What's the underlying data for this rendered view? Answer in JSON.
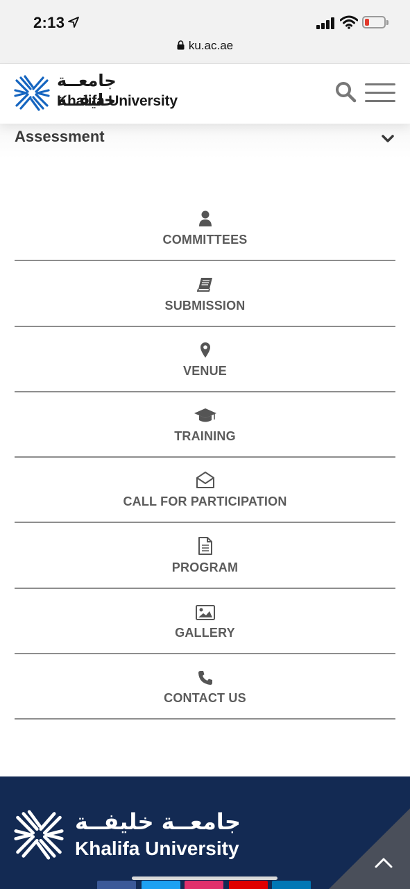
{
  "status_bar": {
    "time": "2:13",
    "url": "ku.ac.ae"
  },
  "header": {
    "logo_arabic": "جامعــة خليفــة",
    "logo_english": "Khalifa University",
    "search_icon": "search-icon",
    "menu_icon": "hamburger-menu-icon"
  },
  "accordion": {
    "title": "Assessment",
    "icon": "chevron-down-icon"
  },
  "nav": {
    "items": [
      {
        "label": "COMMITTEES",
        "icon": "user-icon"
      },
      {
        "label": "SUBMISSION",
        "icon": "book-icon"
      },
      {
        "label": "VENUE",
        "icon": "map-marker-icon"
      },
      {
        "label": "TRAINING",
        "icon": "graduation-cap-icon"
      },
      {
        "label": "CALL FOR PARTICIPATION",
        "icon": "envelope-open-icon"
      },
      {
        "label": "PROGRAM",
        "icon": "document-icon"
      },
      {
        "label": "GALLERY",
        "icon": "image-icon"
      },
      {
        "label": "CONTACT US",
        "icon": "phone-icon"
      }
    ]
  },
  "footer": {
    "logo_arabic": "جامعــة خليفــة",
    "logo_english": "Khalifa University",
    "scroll_top_icon": "chevron-up-icon",
    "colors": {
      "background": "#132a53",
      "brand_blue": "#1565c0"
    }
  }
}
